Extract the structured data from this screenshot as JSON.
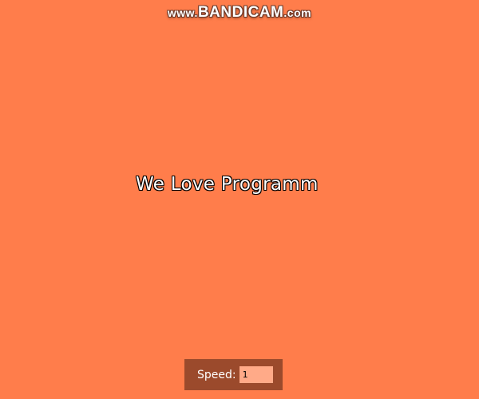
{
  "watermark": {
    "prefix": "www.",
    "brand": "BANDICAM",
    "suffix": ".com"
  },
  "main": {
    "typing_text": "We Love Programm"
  },
  "controls": {
    "speed_label": "Speed:",
    "speed_value": "1"
  },
  "colors": {
    "background": "#ff7d4b",
    "panel": "#9b4a2c",
    "input_background": "#ffaa88",
    "text": "#ffffff",
    "text_outline": "#000000"
  }
}
